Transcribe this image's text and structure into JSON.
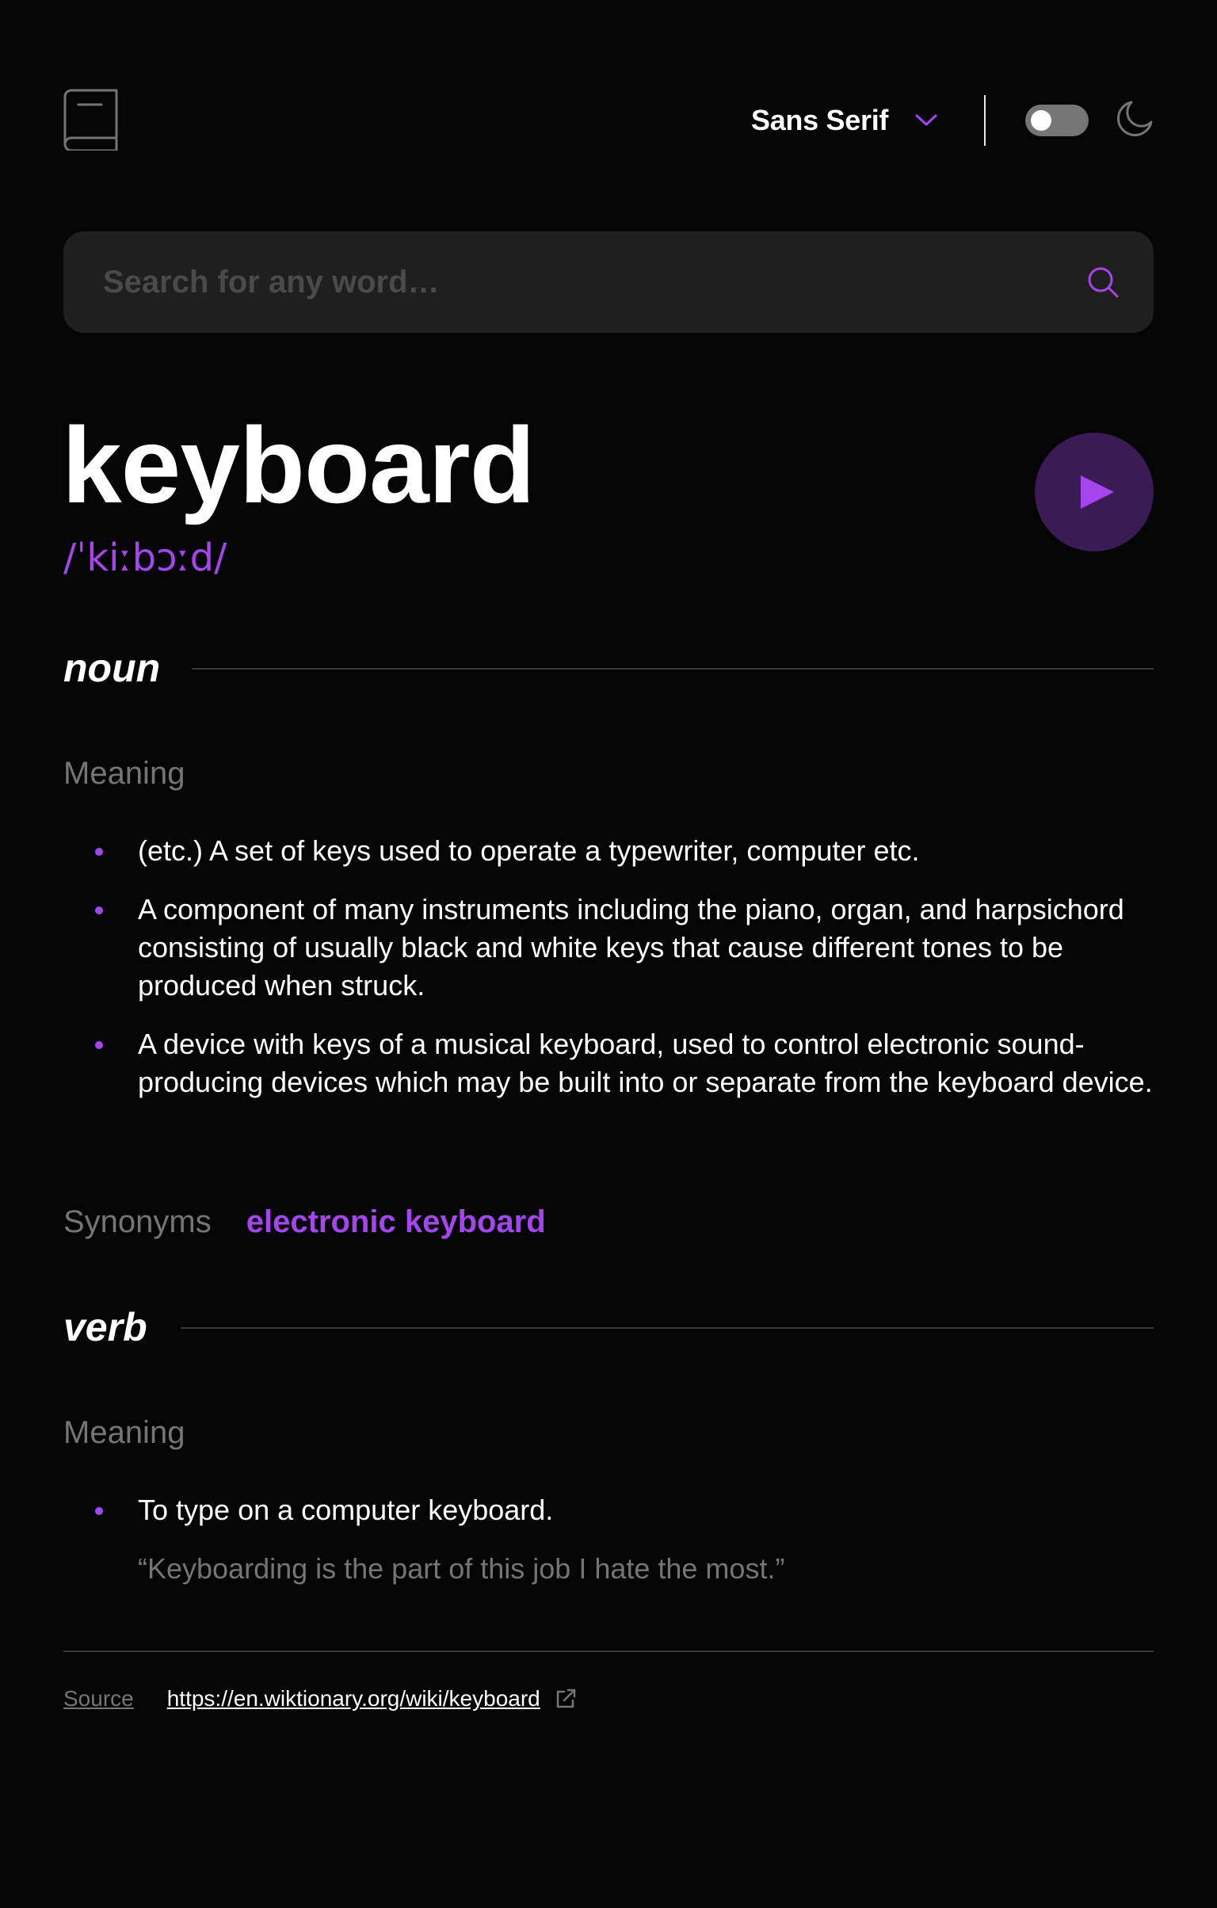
{
  "header": {
    "font_selector": {
      "label": "Sans Serif"
    },
    "theme_toggle": {
      "state": "off"
    }
  },
  "search": {
    "value": "",
    "placeholder": "Search for any word…"
  },
  "entry": {
    "word": "keyboard",
    "phonetic": "/ˈkiːbɔːd/",
    "meanings": [
      {
        "part_of_speech": "noun",
        "heading": "Meaning",
        "definitions": [
          "(etc.) A set of keys used to operate a typewriter, computer etc.",
          "A component of many instruments including the piano, organ, and harpsichord consisting of usually black and white keys that cause different tones to be produced when struck.",
          "A device with keys of a musical keyboard, used to control electronic sound-producing devices which may be built into or separate from the keyboard device."
        ],
        "synonyms_label": "Synonyms",
        "synonyms": [
          "electronic keyboard"
        ]
      },
      {
        "part_of_speech": "verb",
        "heading": "Meaning",
        "definitions": [
          {
            "text": "To type on a computer keyboard.",
            "example": "“Keyboarding is the part of this job I hate the most.”"
          }
        ]
      }
    ]
  },
  "footer": {
    "source_label": "Source",
    "source_url": "https://en.wiktionary.org/wiki/keyboard"
  },
  "colors": {
    "background": "#050505",
    "accent": "#a445ed",
    "muted": "#757575",
    "search_bg": "#1f1f1f",
    "play_bg": "#3a1b55"
  },
  "icons": {
    "logo": "book-icon",
    "dropdown": "chevron-down-icon",
    "theme": "moon-icon",
    "search": "search-icon",
    "play": "play-icon",
    "external": "external-link-icon"
  }
}
